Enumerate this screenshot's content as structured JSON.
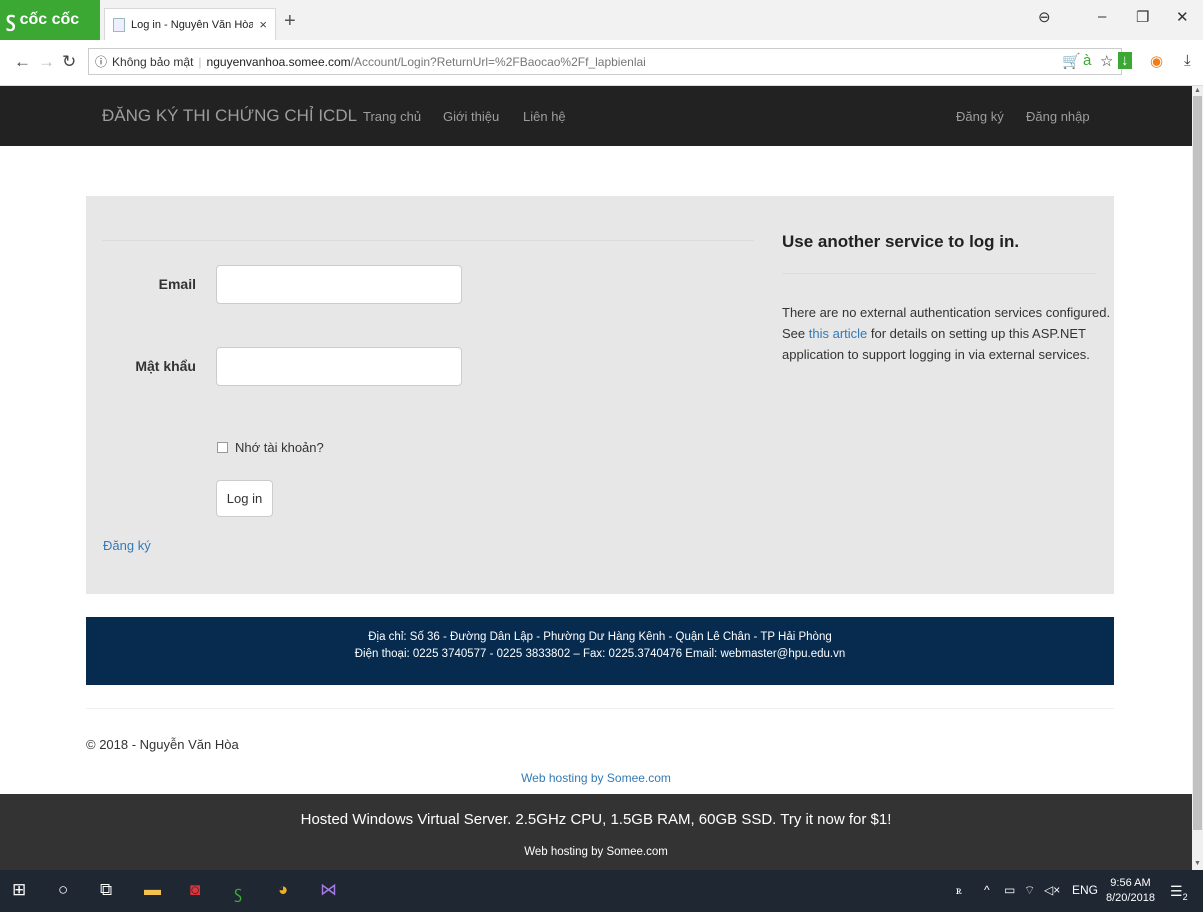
{
  "browser": {
    "brand": "cốc cốc",
    "tab_title": "Log in - Nguyễn Văn Hòa",
    "tab_close": "×",
    "new_tab": "+",
    "security_label": "Không bảo mật",
    "url_domain": "nguyenvanhoa.somee.com",
    "url_path": "/Account/Login?ReturnUrl=%2FBaocao%2Ff_lapbienlai"
  },
  "navbar": {
    "brand": "ĐĂNG KÝ THI CHỨNG CHỈ ICDL",
    "links": [
      "Trang chủ",
      "Giới thiệu",
      "Liên hệ"
    ],
    "register": "Đăng ký",
    "login": "Đăng nhập"
  },
  "login_form": {
    "email_label": "Email",
    "email_value": "",
    "password_label": "Mật khẩu",
    "password_value": "",
    "remember_label": "Nhớ tài khoản?",
    "submit_label": "Log in",
    "register_link": "Đăng ký"
  },
  "external": {
    "heading": "Use another service to log in.",
    "text_before": "There are no external authentication services configured. See ",
    "link_text": "this article",
    "text_after": " for details on setting up this ASP.NET application to support logging in via external services."
  },
  "footer": {
    "address": "Địa chỉ: Số 36 - Đường Dân Lập - Phường Dư Hàng Kênh - Quận Lê Chân - TP Hải Phòng",
    "contact": "Điện thoại: 0225 3740577 - 0225 3833802 – Fax: 0225.3740476 Email: webmaster@hpu.edu.vn",
    "copyright": "© 2018 - Nguyễn Văn Hòa"
  },
  "hosting": {
    "link": "Web hosting by Somee.com",
    "banner": "Hosted Windows Virtual Server. 2.5GHz CPU, 1.5GB RAM, 60GB SSD. Try it now for $1!",
    "banner_sub": "Web hosting by Somee.com"
  },
  "taskbar": {
    "language": "ENG",
    "time": "9:56 AM",
    "date": "8/20/2018",
    "notification_count": "2"
  },
  "colors": {
    "brand_green": "#3ca834",
    "navbar_bg": "#222222",
    "footer_band": "#062b4f",
    "link_blue": "#337ab7",
    "taskbar_bg": "#1f2733"
  }
}
